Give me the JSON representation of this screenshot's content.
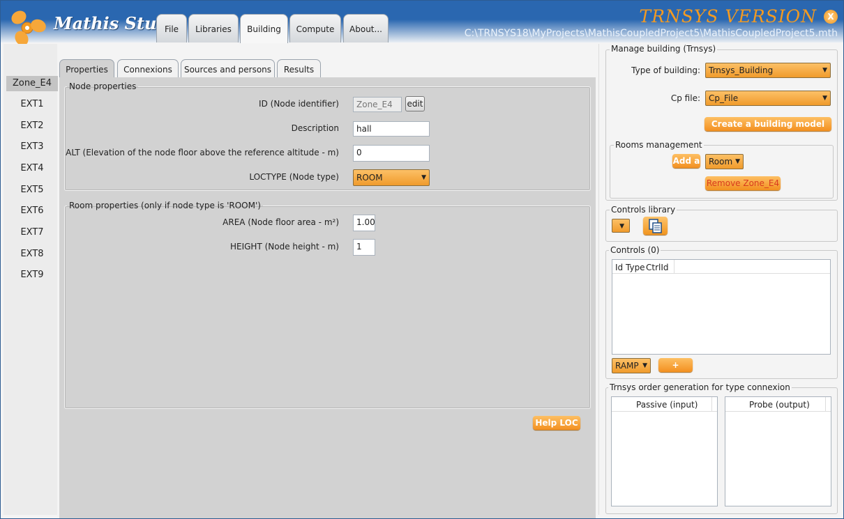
{
  "app": {
    "title": "Mathis Studio",
    "version_label": "TRNSYS VERSION",
    "close_label": "X",
    "file_path": "C:\\TRNSYS18\\MyProjects\\MathisCoupledProject5\\MathisCoupledProject5.mth",
    "accent_color": "#f29a22",
    "titlebar_color": "#2a67b0"
  },
  "main_tabs": [
    "File",
    "Libraries",
    "Building",
    "Compute",
    "About..."
  ],
  "active_main_tab": "Building",
  "zones": [
    "Zone_E4",
    "EXT1",
    "EXT2",
    "EXT3",
    "EXT4",
    "EXT5",
    "EXT6",
    "EXT7",
    "EXT8",
    "EXT9"
  ],
  "selected_zone": "Zone_E4",
  "sub_tabs": [
    "Properties",
    "Connexions",
    "Sources and persons",
    "Results"
  ],
  "active_sub_tab": "Properties",
  "node_properties": {
    "legend": "Node properties",
    "id_label": "ID (Node identifier)",
    "id_value": "Zone_E4",
    "edit_label": "edit",
    "description_label": "Description",
    "description_value": "hall",
    "alt_label": "ALT (Elevation of the node floor above the reference altitude - m)",
    "alt_value": "0",
    "loctype_label": "LOCTYPE (Node type)",
    "loctype_value": "ROOM"
  },
  "room_properties": {
    "legend": "Room properties (only if node type is 'ROOM')",
    "area_label": "AREA (Node floor area - m²)",
    "area_value": "1.00",
    "height_label": "HEIGHT (Node height - m)",
    "height_value": "1"
  },
  "help_button": "Help LOC",
  "manage_building": {
    "legend": "Manage building (Trnsys)",
    "type_label": "Type of building:",
    "type_value": "Trnsys_Building",
    "cp_label": "Cp file:",
    "cp_value": "Cp_File",
    "create_button": "Create a building model"
  },
  "rooms_management": {
    "legend": "Rooms management",
    "add_button": "Add a",
    "room_type_value": "Room",
    "remove_button": "Remove Zone_E4"
  },
  "controls_library": {
    "legend": "Controls library"
  },
  "controls": {
    "legend": "Controls (0)",
    "columns": [
      "Id",
      "Type",
      "CtrlId"
    ],
    "ramp_value": "RAMP",
    "add_button": "+"
  },
  "trnsys_order": {
    "legend": "Trnsys order generation for type connexion",
    "passive_header": "Passive (input)",
    "probe_header": "Probe (output)"
  }
}
